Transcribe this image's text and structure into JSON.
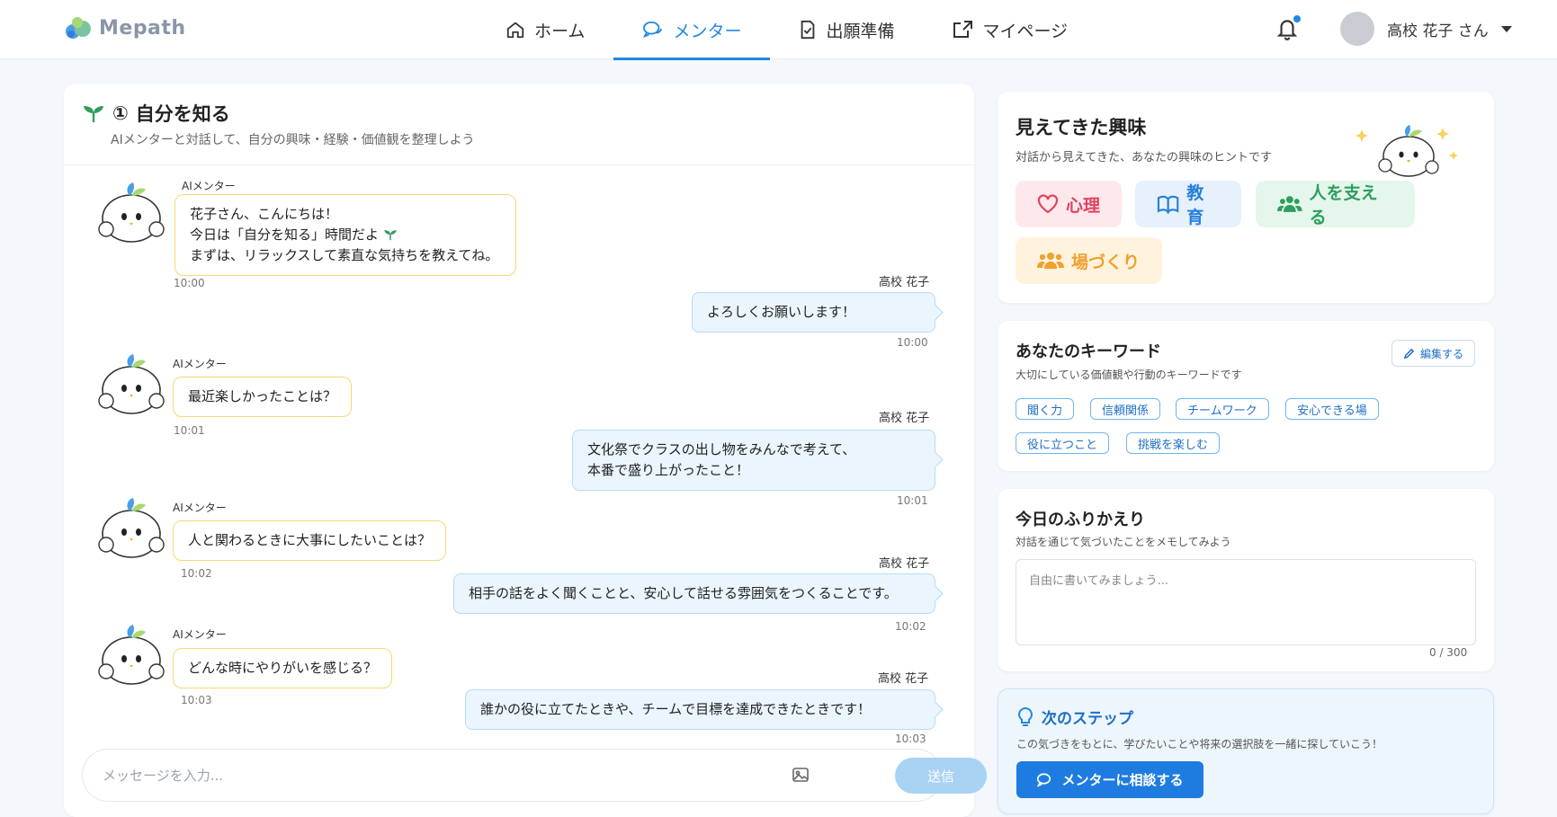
{
  "header": {
    "logo_text": "Mepath",
    "nav": [
      {
        "label": "ホーム",
        "icon": "home-icon"
      },
      {
        "label": "メンター",
        "icon": "chat-icon"
      },
      {
        "label": "出願準備",
        "icon": "document-check-icon"
      },
      {
        "label": "マイページ",
        "icon": "external-link-icon"
      }
    ],
    "active_nav": "メンター",
    "user_name": "高校 花子 さん"
  },
  "chat": {
    "step_number": "①",
    "title": "自分を知る",
    "subtitle": "AIメンターと対話して、自分の興味・経験・価値観を整理しよう",
    "ai_name": "AIメンター",
    "user_name": "高校 花子",
    "messages": [
      {
        "from": "ai",
        "lines": [
          "花子さん、こんにちは！",
          "今日は「自分を知る」時間だよ",
          "まずは、リラックスして素直な気持ちを教えてね。"
        ],
        "time": "10:00"
      },
      {
        "from": "user",
        "lines": [
          "よろしくお願いします！"
        ],
        "time": "10:00"
      },
      {
        "from": "ai",
        "lines": [
          "最近楽しかったことは？"
        ],
        "time": "10:01"
      },
      {
        "from": "user",
        "lines": [
          "文化祭でクラスの出し物をみんなで考えて、",
          "本番で盛り上がったこと！"
        ],
        "time": "10:01"
      },
      {
        "from": "ai",
        "lines": [
          "人と関わるときに大事にしたいことは？"
        ],
        "time": "10:02"
      },
      {
        "from": "user",
        "lines": [
          "相手の話をよく聞くことと、安心して話せる雰囲気をつくることです。"
        ],
        "time": "10:02"
      },
      {
        "from": "ai",
        "lines": [
          "どんな時にやりがいを感じる？"
        ],
        "time": "10:03"
      },
      {
        "from": "user",
        "lines": [
          "誰かの役に立てたときや、チームで目標を達成できたときです！"
        ],
        "time": "10:03"
      }
    ],
    "input_placeholder": "メッセージを入力...",
    "send_label": "送信"
  },
  "interests": {
    "title": "見えてきた興味",
    "subtitle": "対話から見えてきた、あなたの興味のヒントです",
    "chips": [
      {
        "label": "心理",
        "icon": "heart-icon",
        "bg": "#fde8ec",
        "color": "#e0445f"
      },
      {
        "label": "教育",
        "icon": "book-icon",
        "bg": "#e6f1fc",
        "color": "#2680d9"
      },
      {
        "label": "人を支える",
        "icon": "people-icon",
        "bg": "#e5f6ec",
        "color": "#2f9e5c"
      },
      {
        "label": "場づくり",
        "icon": "group-icon",
        "bg": "#fff3de",
        "color": "#f0a030"
      }
    ]
  },
  "keywords": {
    "title": "あなたのキーワード",
    "subtitle": "大切にしている価値観や行動のキーワードです",
    "edit_label": "編集する",
    "items": [
      "聞く力",
      "信頼関係",
      "チームワーク",
      "安心できる場",
      "役に立つこと",
      "挑戦を楽しむ"
    ]
  },
  "reflection": {
    "title": "今日のふりかえり",
    "subtitle": "対話を通じて気づいたことをメモしてみよう",
    "placeholder": "自由に書いてみましょう...",
    "counter": "0 / 300"
  },
  "next_step": {
    "title": "次のステップ",
    "subtitle": "この気づきをもとに、学びたいことや将来の選択肢を一緒に探していこう！",
    "button_label": "メンターに相談する"
  },
  "colors": {
    "accent": "#1e88e5",
    "ai_bubble_border": "#f5d973",
    "user_bubble_bg": "#eaf5fd"
  }
}
